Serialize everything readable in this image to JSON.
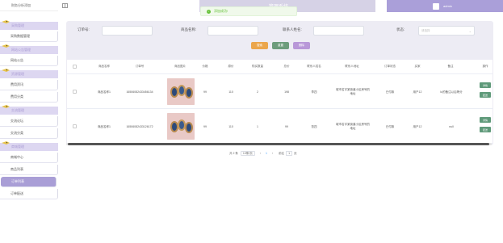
{
  "sidebar": {
    "top_label": "财务分析添加",
    "groups": [
      {
        "title": "采购管理",
        "items": [
          {
            "label": "采购数据管理"
          }
        ]
      },
      {
        "title": "网站公告管理",
        "items": [
          {
            "label": "网站公告"
          }
        ]
      },
      {
        "title": "资源管理",
        "items": [
          {
            "label": "费用资讯"
          },
          {
            "label": "费用分类"
          }
        ]
      },
      {
        "title": "交流管理",
        "items": [
          {
            "label": "交流论坛"
          },
          {
            "label": "交流分类"
          }
        ]
      },
      {
        "title": "商城管理",
        "items": [
          {
            "label": "商城中心"
          },
          {
            "label": "商品列表"
          },
          {
            "label": "订单列表"
          },
          {
            "label": "订单配送"
          }
        ]
      }
    ]
  },
  "header": {
    "title": "…管理系统",
    "user": "admin"
  },
  "toast": {
    "message": "添加成功!",
    "icon": "check-icon"
  },
  "filters": {
    "order_no_label": "订单号:",
    "goods_name_label": "商品名称:",
    "contact_label": "联系人姓名:",
    "status_label": "状态:",
    "status_placeholder": "请选择"
  },
  "buttons": {
    "search": "搜索",
    "reset": "重置",
    "delete": "删除"
  },
  "table": {
    "headers": [
      "商品名称",
      "订单号",
      "商品图片",
      "价格",
      "原价",
      "购买数量",
      "总价",
      "联系人姓名",
      "联系人地址",
      "订单状态",
      "买家",
      "备注",
      "操作"
    ],
    "rows": [
      {
        "name": "商品名称1",
        "order_no": "16506082433456134",
        "price": "99",
        "orig": "110",
        "qty": "2",
        "total": "198",
        "contact": "李四",
        "address": "城市名字某街道小区房号的地址",
        "status": "已付款",
        "buyer": "用户12",
        "note": "lu的备注以后等分"
      },
      {
        "name": "商品名称1",
        "order_no": "16506082433126172",
        "price": "99",
        "orig": "110",
        "qty": "1",
        "total": "99",
        "contact": "张四",
        "address": "城市名字某街道小区房号的地址",
        "status": "已付款",
        "buyer": "用户12",
        "note": "null"
      }
    ],
    "op_view": "详情",
    "op_edit": "配送"
  },
  "pager": {
    "total": "共 2 条",
    "size": "10条/页",
    "prev": "‹",
    "page": "1",
    "next": "›",
    "goto": "前往",
    "goto_page": "1",
    "unit": "页"
  },
  "colors": {
    "accent": "#aa9fd9",
    "sidebar_active": "#a99ed6",
    "btn_search": "#eba64c",
    "btn_reset": "#6d9c7c",
    "btn_delete": "#b897d8",
    "op_button": "#5f9a7a"
  }
}
